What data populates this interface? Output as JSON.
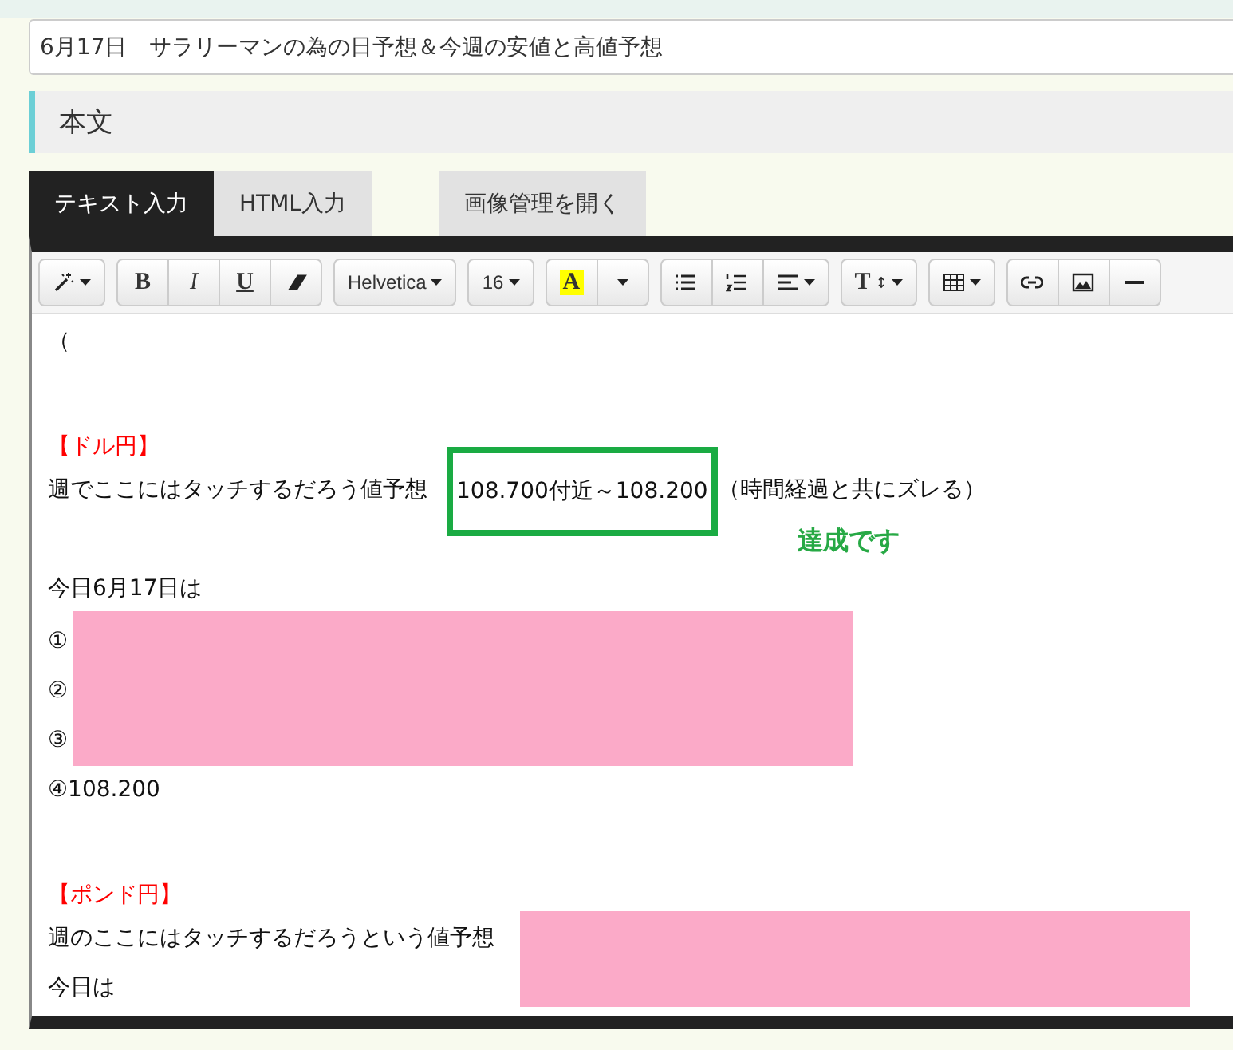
{
  "title_field": {
    "value": "6月17日　サラリーマンの為の日予想＆今週の安値と高値予想"
  },
  "section_heading": "本文",
  "tabs": [
    {
      "label": "テキスト入力",
      "selected": true
    },
    {
      "label": "HTML入力",
      "selected": false
    }
  ],
  "image_button": "画像管理を開く",
  "toolbar": [
    [
      {
        "kind": "wand"
      }
    ],
    [
      {
        "kind": "bold",
        "label": "B"
      },
      {
        "kind": "italic",
        "label": "I"
      },
      {
        "kind": "underline",
        "label": "U"
      },
      {
        "kind": "eraser"
      }
    ],
    [
      {
        "kind": "dropdown",
        "label": "Helvetica"
      }
    ],
    [
      {
        "kind": "dropdown",
        "label": "16"
      }
    ],
    [
      {
        "kind": "color",
        "label": "A",
        "color": "#ffff00"
      },
      {
        "kind": "caret"
      }
    ],
    [
      {
        "kind": "ul"
      },
      {
        "kind": "ol"
      },
      {
        "kind": "align"
      }
    ],
    [
      {
        "kind": "textsize",
        "label": "T"
      }
    ],
    [
      {
        "kind": "table"
      }
    ],
    [
      {
        "kind": "link"
      },
      {
        "kind": "image"
      },
      {
        "kind": "hr"
      }
    ]
  ],
  "content": [
    {
      "kind": "text",
      "text": "（"
    },
    {
      "kind": "blank"
    },
    {
      "kind": "heading",
      "text": "【ドル円】"
    },
    {
      "kind": "boxed",
      "before": "週でここにはタッチするだろう値予想",
      "boxed": "108.700付近～108.200",
      "after": "（時間経過と共にズレる）",
      "note": "達成です"
    },
    {
      "kind": "text",
      "text": "今日6月17日は"
    },
    {
      "kind": "redacted_list",
      "marks": [
        "①",
        "②",
        "③"
      ]
    },
    {
      "kind": "text",
      "text": "④108.200"
    },
    {
      "kind": "blank"
    },
    {
      "kind": "heading",
      "text": "【ポンド円】"
    },
    {
      "kind": "redacted_text",
      "text": "週のここにはタッチするだろうという値予想"
    },
    {
      "kind": "text",
      "text": "今日は"
    }
  ]
}
